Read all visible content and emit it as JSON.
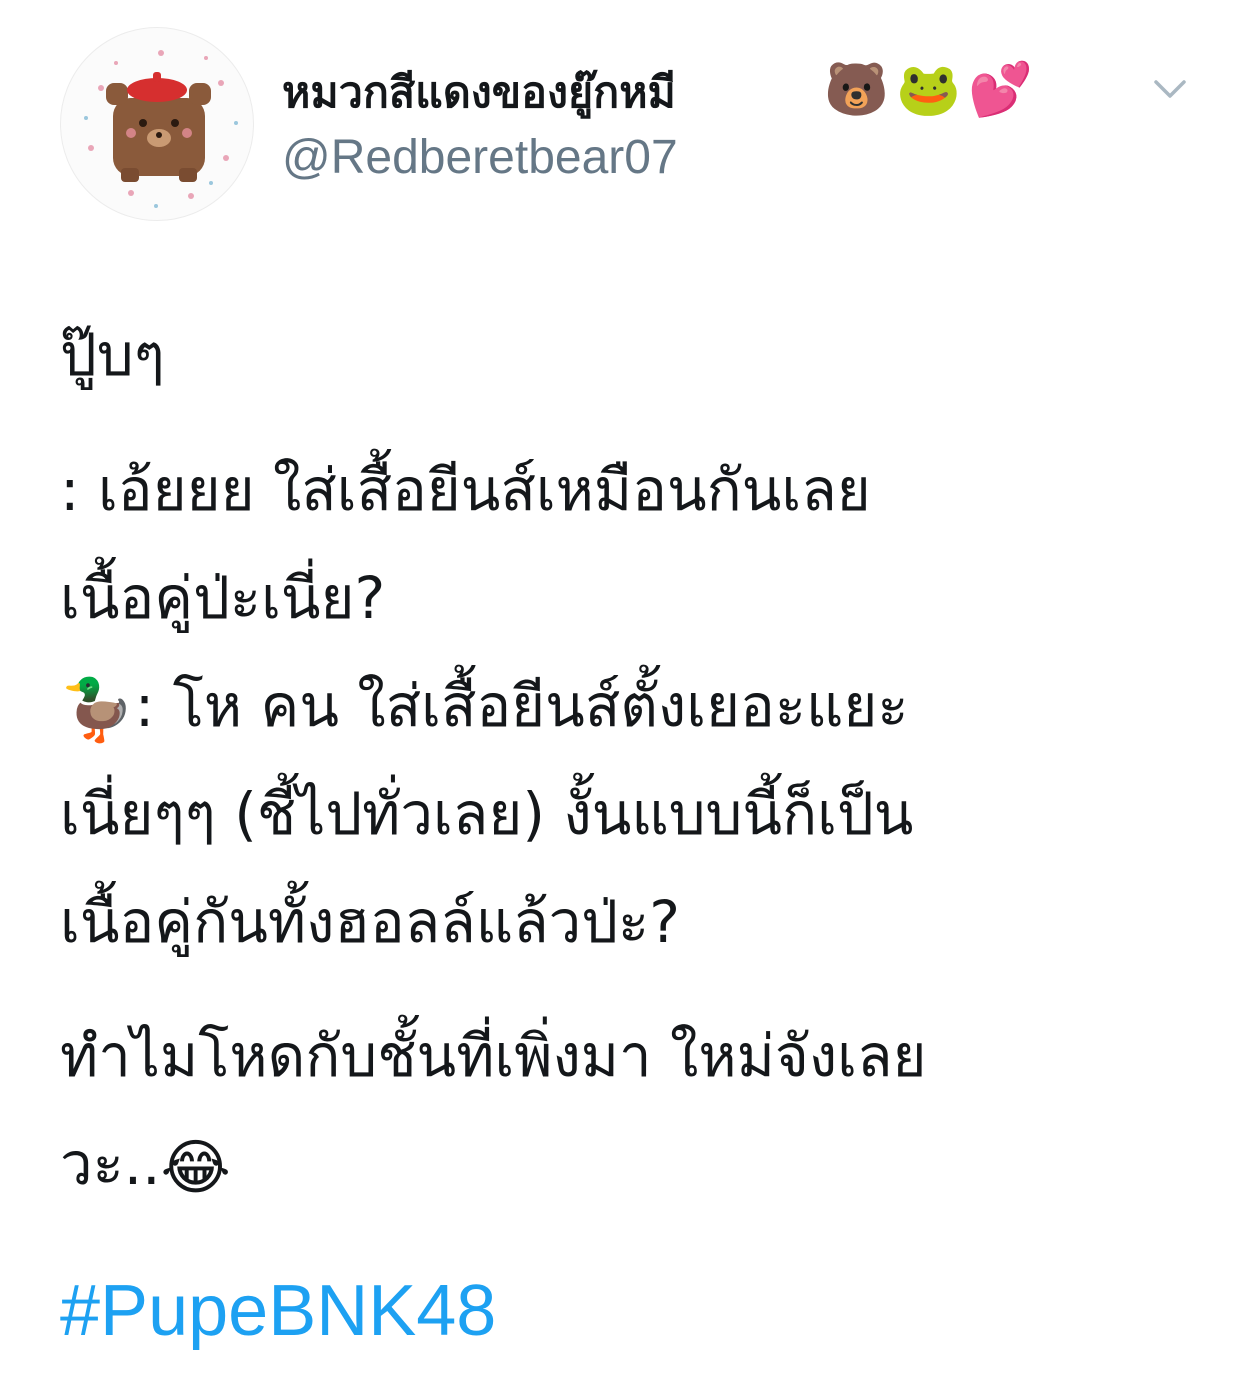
{
  "author": {
    "display_name": "หมวกสีแดงของยู๊กหมี",
    "name_emojis": [
      "🐻",
      "🐸",
      "💕"
    ],
    "handle": "@Redberetbear07",
    "avatar_icon": "bear-with-red-beret-avatar"
  },
  "menu": {
    "icon": "chevron-down-icon"
  },
  "tweet": {
    "lines": [
      "ปู๊บๆ",
      ": เอ้ยยย ใส่เสื้อยีนส์เหมือนกันเลย",
      "เนื้อคู่ป่ะเนี่ย?",
      ": โห คน ใส่เสื้อยีนส์ตั้งเยอะแยะ",
      "เนี่ยๆๆ (ชี้ไปทั่วเลย) งั้นแบบนี้ก็เป็น",
      "เนื้อคู่กันทั้งฮอลล์แล้วป่ะ?",
      "ทำไมโหดกับชั้นที่เพิ่งมา ใหม่จังเลย",
      "วะ.."
    ],
    "duck_emoji": "🦆",
    "laugh_emoji": "😂",
    "hashtag": "#PupeBNK48"
  },
  "colors": {
    "text": "#14171a",
    "secondary": "#657786",
    "link": "#1da1f2",
    "chevron": "#aab8c2"
  }
}
